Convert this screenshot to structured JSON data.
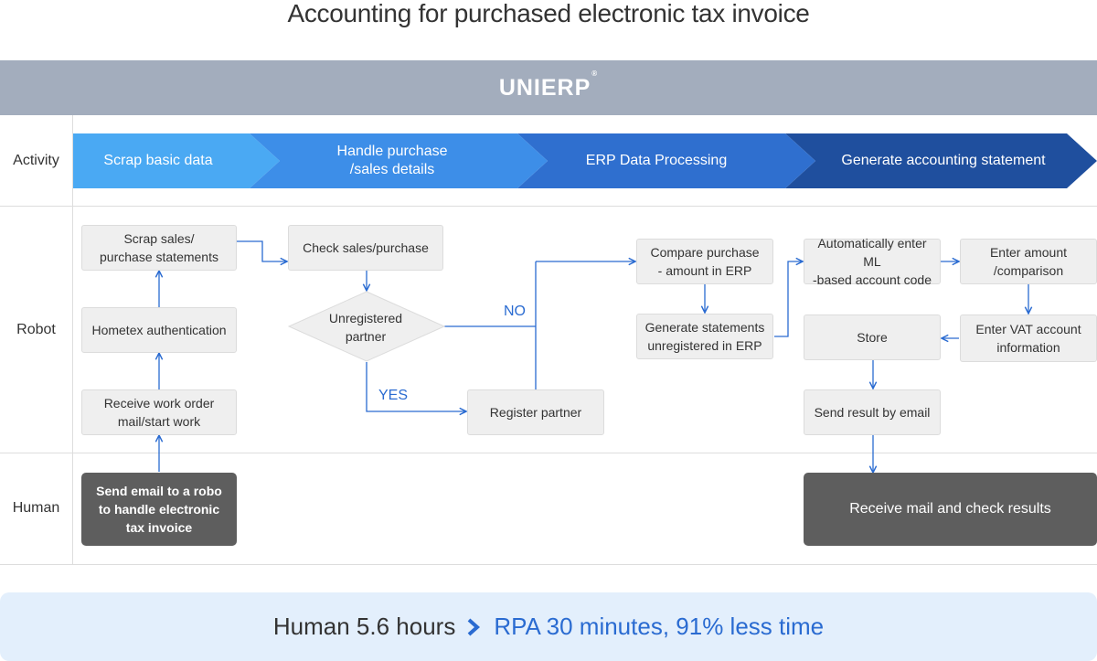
{
  "title": "Accounting for purchased electronic tax invoice",
  "banner": {
    "logo_text": "UNIERP",
    "logo_mark": "®"
  },
  "lanes": {
    "activity": "Activity",
    "robot": "Robot",
    "human": "Human"
  },
  "phases": [
    {
      "label": "Scrap basic data",
      "color": "#4aa9f3"
    },
    {
      "label": "Handle purchase\n/sales details",
      "color": "#3d8ee8"
    },
    {
      "label": "ERP Data Processing",
      "color": "#2f6fcf"
    },
    {
      "label": "Generate accounting statement",
      "color": "#1f4f9e"
    }
  ],
  "nodes": {
    "scrap_statements": "Scrap sales/\npurchase statements",
    "hometex_auth": "Hometex authentication",
    "receive_work_order": "Receive work order\nmail/start work",
    "send_email": "Send email to a robo\nto handle electronic\ntax invoice",
    "check_sales": "Check sales/purchase",
    "unregistered_partner": "Unregistered\npartner",
    "register_partner": "Register partner",
    "compare_purchase": "Compare purchase\n- amount in ERP",
    "generate_statements": "Generate statements\nunregistered in ERP",
    "auto_enter_ml": "Automatically enter ML\n-based account code",
    "enter_amount": "Enter amount\n/comparison",
    "enter_vat": "Enter VAT account\ninformation",
    "store": "Store",
    "send_result": "Send result by email",
    "receive_mail": "Receive mail and check results"
  },
  "edge_labels": {
    "no": "NO",
    "yes": "YES"
  },
  "footer": {
    "human": "Human 5.6 hours",
    "rpa": "RPA 30 minutes, 91% less time"
  },
  "colors": {
    "arrow": "#2a6bd1",
    "banner": "#a3adbd",
    "dark_box": "#5e5e5e",
    "footer_bg": "#e3effc"
  }
}
